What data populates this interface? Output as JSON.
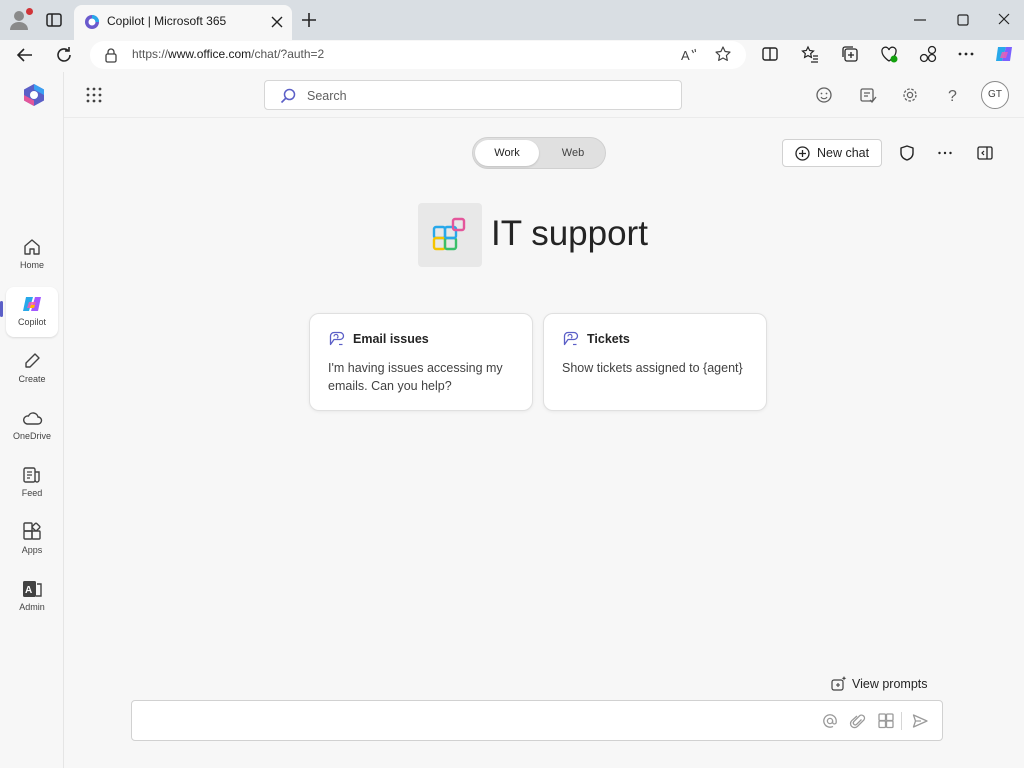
{
  "browser": {
    "tab_title": "Copilot | Microsoft 365",
    "url_prefix": "https://",
    "url_domain": "www.office.com",
    "url_path": "/chat/?auth=2",
    "icons": [
      "profile-icon",
      "tab-actions-icon",
      "copilot-favicon",
      "close-icon",
      "plus-icon",
      "minimize-icon",
      "maximize-icon",
      "close-window-icon",
      "back-icon",
      "refresh-icon",
      "lock-icon",
      "read-aloud-icon",
      "favorite-star-icon",
      "split-screen-icon",
      "favorites-list-icon",
      "collections-icon",
      "browser-essentials-icon",
      "extensions-icon",
      "more-icon",
      "copilot-icon"
    ]
  },
  "rail": {
    "items": [
      {
        "label": "Home",
        "icon": "home-icon"
      },
      {
        "label": "Copilot",
        "icon": "copilot-icon"
      },
      {
        "label": "Create",
        "icon": "pen-icon"
      },
      {
        "label": "OneDrive",
        "icon": "cloud-icon"
      },
      {
        "label": "Feed",
        "icon": "feed-icon"
      },
      {
        "label": "Apps",
        "icon": "apps-icon"
      },
      {
        "label": "Admin",
        "icon": "admin-icon"
      }
    ],
    "active": "Copilot"
  },
  "header": {
    "search_placeholder": "Search",
    "avatar_initials": "GT"
  },
  "mode": {
    "work_label": "Work",
    "web_label": "Web",
    "selected": "Work"
  },
  "toolbar": {
    "new_chat_label": "New chat"
  },
  "agent": {
    "title": "IT support"
  },
  "prompts": [
    {
      "title": "Email issues",
      "text": "I'm having issues accessing my emails. Can you help?"
    },
    {
      "title": "Tickets",
      "text": "Show tickets assigned to {agent}"
    }
  ],
  "composer": {
    "view_prompts_label": "View prompts",
    "message_value": ""
  },
  "colors": {
    "accent": "#5b5fc7",
    "chrome_bg": "#d9dee3",
    "app_bg": "#f7f7f7"
  }
}
